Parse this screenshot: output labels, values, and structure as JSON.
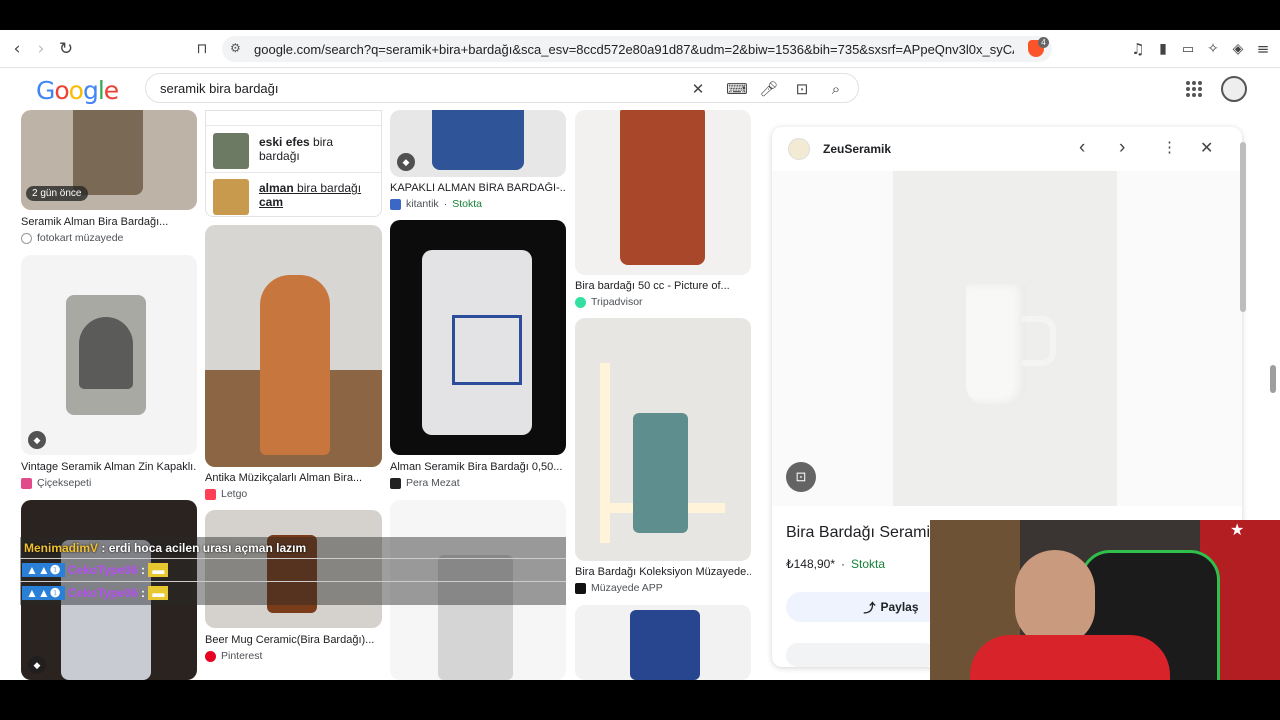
{
  "browser": {
    "url": "google.com/search?q=seramik+bira+bardağı&sca_esv=8ccd572e80a91d87&udm=2&biw=1536&bih=735&sxsrf=APpeQnv3l0x_syCA3Y0z5vwrKl...",
    "brave_badge": "4"
  },
  "google": {
    "logo_letters": [
      "G",
      "o",
      "o",
      "g",
      "l",
      "e"
    ],
    "logo_colors": [
      "#4285f4",
      "#ea4335",
      "#fbbc05",
      "#4285f4",
      "#34a853",
      "#ea4335"
    ],
    "query": "seramik bira bardağı"
  },
  "suggestions": [
    {
      "bold": "eski efes",
      "rest": " bira bardağı"
    },
    {
      "bold": "alman",
      "rest": " bira bardağı",
      "bold2": "cam"
    }
  ],
  "results": {
    "c1": [
      {
        "title": "Seramik Alman Bira Bardağı...",
        "source": "fotokart müzayede",
        "badge": "2 gün önce"
      },
      {
        "title": "Vintage Seramik Alman Zin Kapaklı...",
        "source": "Çiçeksepeti"
      }
    ],
    "c2": [
      {
        "title": "Antika Müzikçalarlı Alman Bira...",
        "source": "Letgo"
      },
      {
        "title": "Beer Mug Ceramic(Bira Bardağı)...",
        "source": "Pinterest"
      }
    ],
    "c3": [
      {
        "title": "KAPAKLI ALMAN BİRA BARDAĞI-...",
        "source": "kitantik",
        "stock": "Stokta"
      },
      {
        "title": "Alman Seramik Bira Bardağı 0,50...",
        "source": "Pera Mezat"
      }
    ],
    "c4": [
      {
        "title": "Bira bardağı 50 cc - Picture of...",
        "source": "Tripadvisor"
      },
      {
        "title": "Bira Bardağı Koleksiyon Müzayede...",
        "source": "Müzayede APP"
      }
    ]
  },
  "panel": {
    "site": "ZeuSeramik",
    "title": "Bira Bardağı Seramik B",
    "price": "₺148,90*",
    "stock": "Stokta",
    "share": "Paylaş"
  },
  "chat": [
    {
      "user": "MenimadimV",
      "msg": ": erdi hoca acilen",
      "msg2": "urası açman lazım"
    },
    {
      "user": "CekoType06",
      "msg": ":"
    },
    {
      "user": "CekoType06",
      "msg": ":"
    }
  ],
  "colors": {
    "stock": "#188038",
    "link": "#1a0dab",
    "chat_user": "#f0c030",
    "chat_user2": "#b44ef0"
  }
}
